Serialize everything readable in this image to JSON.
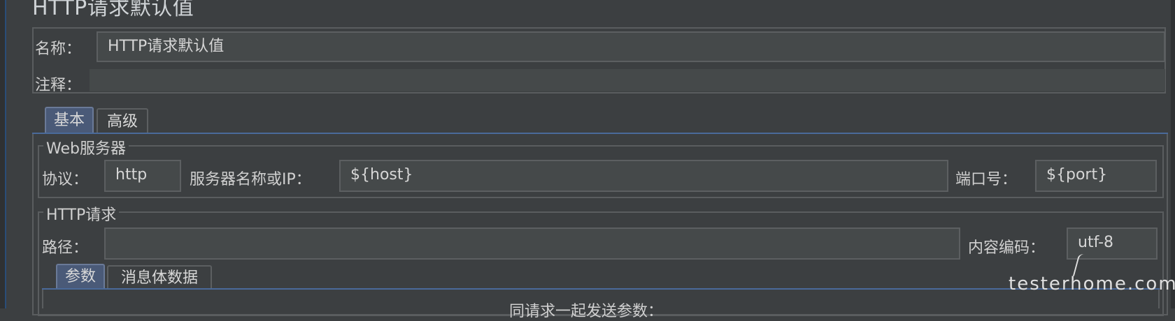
{
  "title": "HTTP请求默认值",
  "name_label": "名称：",
  "name_value": "HTTP请求默认值",
  "comment_label": "注释：",
  "comment_value": "",
  "tabs": [
    {
      "label": "基本",
      "active": true
    },
    {
      "label": "高级",
      "active": false
    }
  ],
  "web_server": {
    "legend": "Web服务器",
    "protocol_label": "协议：",
    "protocol_value": "http",
    "server_label": "服务器名称或IP：",
    "server_value": "${host}",
    "port_label": "端口号：",
    "port_value": "${port}"
  },
  "http_request": {
    "legend": "HTTP请求",
    "path_label": "路径：",
    "path_value": "",
    "encoding_label": "内容编码：",
    "encoding_value": "utf-8"
  },
  "sub_tabs": [
    {
      "label": "参数",
      "active": true
    },
    {
      "label": "消息体数据",
      "active": false
    }
  ],
  "params_caption": "同请求一起发送参数：",
  "watermark": "testerhome.com"
}
